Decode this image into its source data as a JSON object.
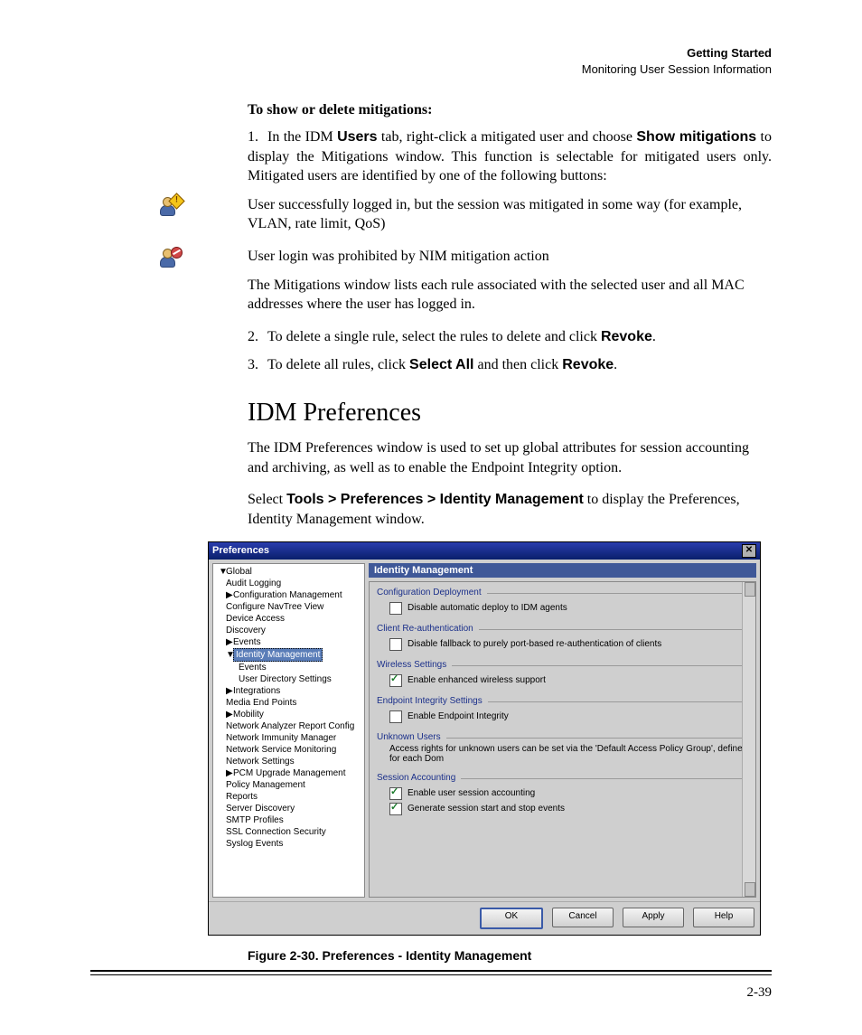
{
  "header": {
    "chapter": "Getting Started",
    "section": "Monitoring User Session Information"
  },
  "sec1": {
    "title": "To show or delete mitigations:",
    "step1a": "In the IDM ",
    "step1b": "Users",
    "step1c": " tab, right-click a mitigated user and choose ",
    "step1d": "Show mitigations",
    "step1e": " to display the Mitigations window. This function is selectable for mitigated users only. Mitigated users are identified by one of the following buttons:",
    "icon1": "User successfully logged in, but the session was mitigated in some way (for example, VLAN, rate limit, QoS)",
    "icon2": "User login was prohibited by NIM mitigation action",
    "after": "The Mitigations window lists each rule associated with the selected user and all MAC addresses where the user has logged in.",
    "step2a": "To delete a single rule, select the rules to delete and click ",
    "step2b": "Revoke",
    "step3a": "To delete all rules, click ",
    "step3b": "Select All",
    "step3c": " and then click ",
    "step3d": "Revoke"
  },
  "sec2": {
    "title": "IDM Preferences",
    "p1": "The IDM Preferences window is used to set up global attributes for session accounting and archiving, as well as to enable the Endpoint Integrity option.",
    "p2a": "Select ",
    "p2b": "Tools > Preferences > Identity Management",
    "p2c": " to display the Preferences, Identity Management window."
  },
  "prefs": {
    "title": "Preferences",
    "tree": {
      "global": "Global",
      "items": [
        "Audit Logging",
        "Configuration Management",
        "Configure NavTree View",
        "Device Access",
        "Discovery",
        "Events",
        "Identity Management",
        "Events",
        "User Directory Settings",
        "Integrations",
        "Media End Points",
        "Mobility",
        "Network Analyzer Report Config",
        "Network Immunity Manager",
        "Network Service Monitoring",
        "Network Settings",
        "PCM Upgrade Management",
        "Policy Management",
        "Reports",
        "Server Discovery",
        "SMTP Profiles",
        "SSL Connection Security",
        "Syslog Events"
      ]
    },
    "pane": {
      "title": "Identity Management",
      "g1": {
        "legend": "Configuration Deployment",
        "cb": "Disable automatic deploy to IDM agents"
      },
      "g2": {
        "legend": "Client Re-authentication",
        "cb": "Disable fallback to purely port-based re-authentication of clients"
      },
      "g3": {
        "legend": "Wireless Settings",
        "cb": "Enable enhanced wireless support"
      },
      "g4": {
        "legend": "Endpoint Integrity Settings",
        "cb": "Enable Endpoint Integrity"
      },
      "g5": {
        "legend": "Unknown Users",
        "text": "Access rights for unknown users can be set via the 'Default Access Policy Group', defined for each Dom"
      },
      "g6": {
        "legend": "Session Accounting",
        "cb1": "Enable user session accounting",
        "cb2": "Generate session start and stop events"
      }
    },
    "buttons": {
      "ok": "OK",
      "cancel": "Cancel",
      "apply": "Apply",
      "help": "Help"
    }
  },
  "caption": "Figure 2-30. Preferences - Identity Management",
  "pagenum": "2-39"
}
